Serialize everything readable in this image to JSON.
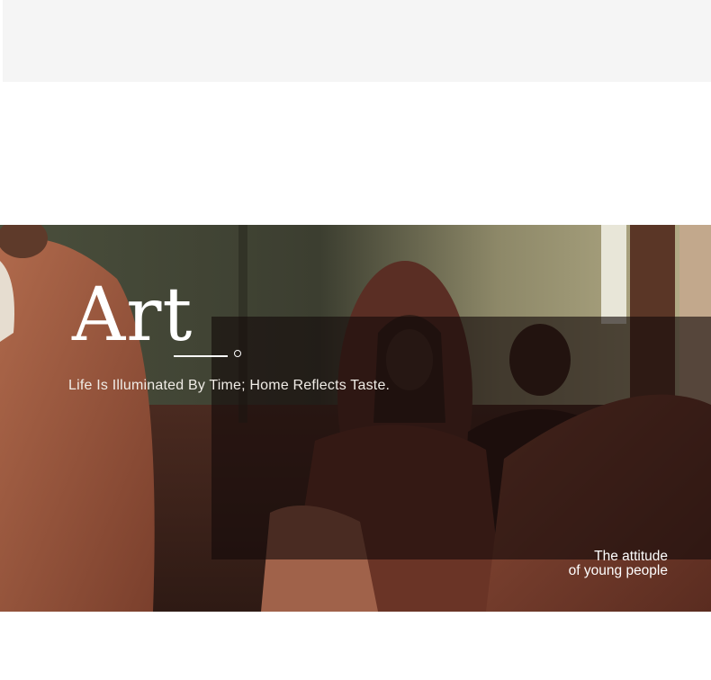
{
  "hero": {
    "title": "Art",
    "tagline": "Life Is Illuminated By Time; Home Reflects Taste.",
    "caption_line1": "The attitude",
    "caption_line2": "of young people"
  },
  "colors": {
    "banner": "#f5f5f5",
    "overlay": "#140a0a",
    "text": "#ffffff"
  }
}
